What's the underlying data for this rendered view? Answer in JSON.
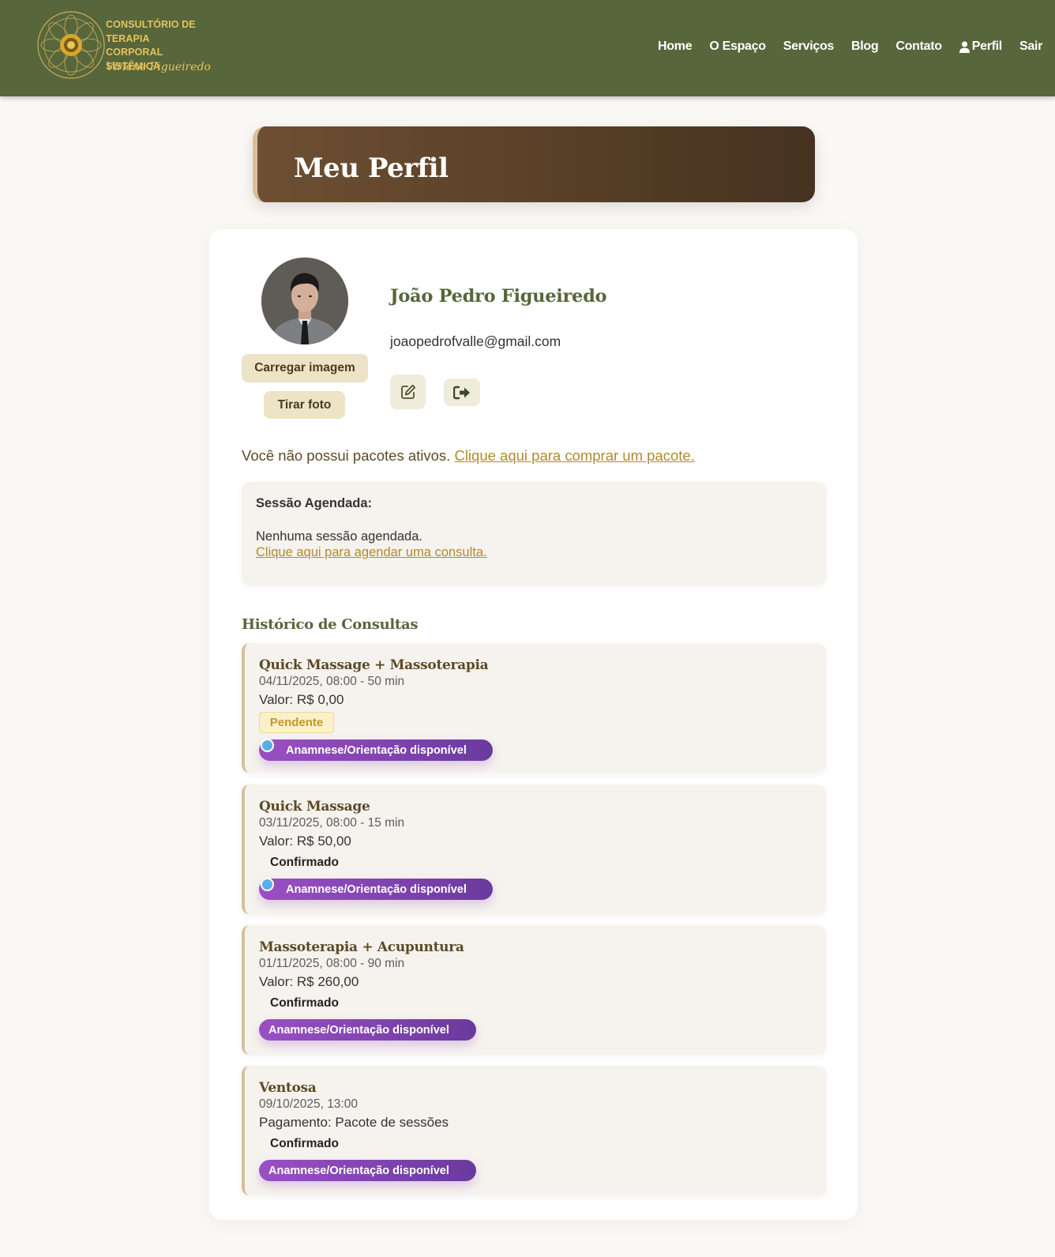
{
  "header": {
    "logo_lines": [
      "CONSULTÓRIO DE",
      "TERAPIA CORPORAL",
      "SISTÊMICA"
    ],
    "logo_script": "Virlene Figueiredo",
    "nav": [
      "Home",
      "O Espaço",
      "Serviços",
      "Blog",
      "Contato",
      "Perfil",
      "Sair"
    ],
    "icons": {
      "profile": "user-icon"
    }
  },
  "page": {
    "title": "Meu Perfil"
  },
  "profile": {
    "upload_label": "Carregar imagem",
    "photo_label": "Tirar foto",
    "name": "João Pedro Figueiredo",
    "email": "joaopedrofvalle@gmail.com",
    "icons": {
      "edit": "edit-icon",
      "logout": "logout-icon"
    }
  },
  "packages": {
    "message": "Você não possui pacotes ativos. ",
    "link": "Clique aqui para comprar um pacote."
  },
  "session": {
    "title": "Sessão Agendada:",
    "empty": "Nenhuma sessão agendada.",
    "link": "Clique aqui para agendar uma consulta."
  },
  "history": {
    "title": "Histórico de Consultas",
    "items": [
      {
        "name": "Quick Massage + Massoterapia",
        "date": "04/11/2025, 08:00 - 50 min",
        "value": "Valor: R$ 0,00",
        "status": "Pendente",
        "anamnese": "Anamnese/Orientação disponível"
      },
      {
        "name": "Quick Massage",
        "date": "03/11/2025, 08:00 - 15 min",
        "value": "Valor: R$ 50,00",
        "status": "Confirmado",
        "anamnese": "Anamnese/Orientação disponível"
      },
      {
        "name": "Massoterapia + Acupuntura",
        "date": "01/11/2025, 08:00 - 90 min",
        "value": "Valor: R$ 260,00",
        "status": "Confirmado",
        "anamnese": "Anamnese/Orientação disponível"
      },
      {
        "name": "Ventosa",
        "date": "09/10/2025, 13:00",
        "value": "Pagamento: Pacote de sessões",
        "status": "Confirmado",
        "anamnese": "Anamnese/Orientação disponível"
      }
    ]
  },
  "colors": {
    "header_bg": "#58663b",
    "accent_gold": "#b08a2e",
    "banner_brown": "#5a4128",
    "pill_purple": "#8a46bd",
    "pending_badge": "#fbf1c9"
  }
}
